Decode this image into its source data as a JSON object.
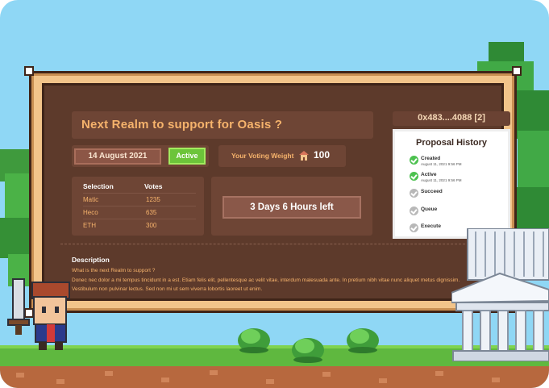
{
  "proposal": {
    "title": "Next Realm to support for Oasis ?",
    "address": "0x483....4088 [2]",
    "date": "14 August 2021",
    "status": "Active"
  },
  "voting_weight": {
    "label": "Your Voting Weight",
    "value": "100",
    "icon": "house-icon"
  },
  "votes": {
    "headers": {
      "selection": "Selection",
      "votes": "Votes"
    },
    "rows": [
      {
        "selection": "Matic",
        "votes": "1235"
      },
      {
        "selection": "Heco",
        "votes": "635"
      },
      {
        "selection": "ETH",
        "votes": "300"
      }
    ]
  },
  "time_left": "3 Days 6 Hours left",
  "history": {
    "title": "Proposal History",
    "items": [
      {
        "label": "Created",
        "time": "August 11, 2021 9:56 PM",
        "state": "done"
      },
      {
        "label": "Active",
        "time": "August 11, 2021 9:56 PM",
        "state": "done"
      },
      {
        "label": "Succeed",
        "time": "",
        "state": "pending"
      },
      {
        "label": "Queue",
        "time": "",
        "state": "pending"
      },
      {
        "label": "Execute",
        "time": "",
        "state": "pending"
      }
    ]
  },
  "description": {
    "title": "Description",
    "question": "What is the next Realm to support ?",
    "body": "Donec nec dolor a mi tempus tincidunt in a est. Etiam felis elit, pellentesque ac velit vitae, interdum malesuada ante. In pretium nibh vitae nunc aliquet metus dignissim. Vestibulum non pulvinar lectus. Sed non mi ut sem viverra lobortis laoreet ut enim."
  },
  "colors": {
    "sky": "#8fd7f5",
    "board_wood": "#5d3a2b",
    "accent_orange": "#f6b36c",
    "active_green": "#6cc43a"
  }
}
